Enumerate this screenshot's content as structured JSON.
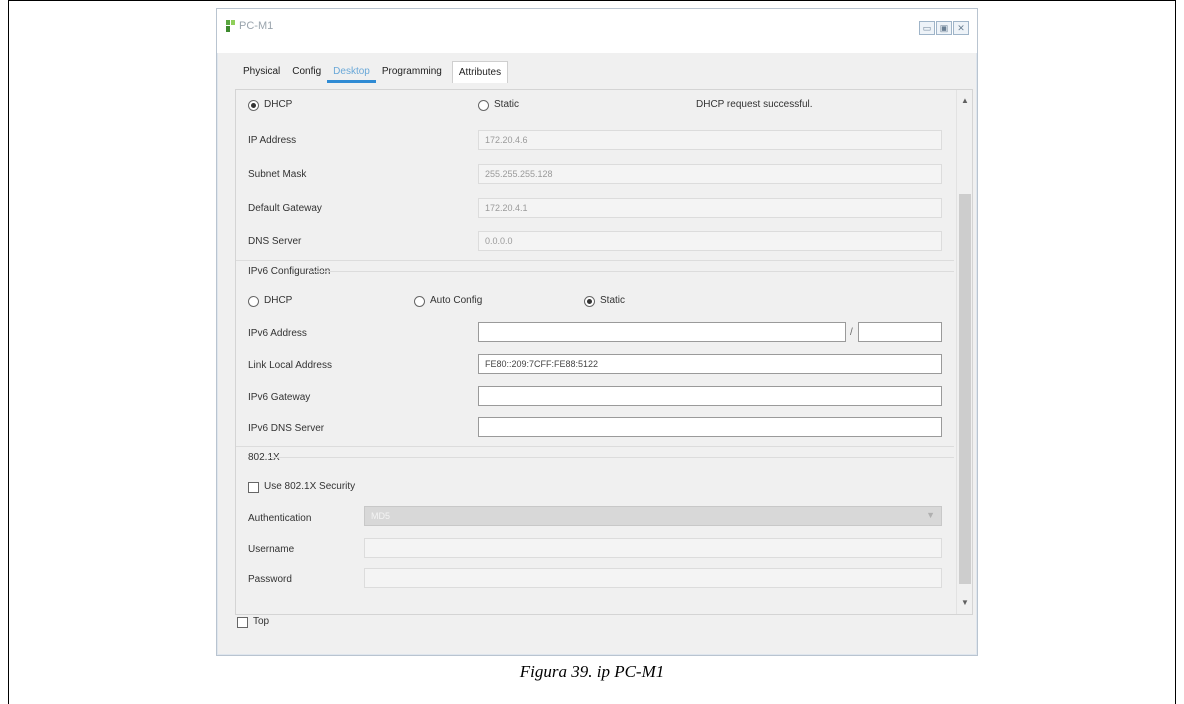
{
  "window": {
    "title": "PC-M1"
  },
  "tabs": [
    {
      "label": "Physical"
    },
    {
      "label": "Config"
    },
    {
      "label": "Desktop"
    },
    {
      "label": "Programming"
    },
    {
      "label": "Attributes"
    }
  ],
  "ipv4": {
    "dhcp_label": "DHCP",
    "static_label": "Static",
    "status": "DHCP request successful.",
    "ip_label": "IP Address",
    "ip_value": "172.20.4.6",
    "mask_label": "Subnet Mask",
    "mask_value": "255.255.255.128",
    "gateway_label": "Default Gateway",
    "gateway_value": "172.20.4.1",
    "dns_label": "DNS Server",
    "dns_value": "0.0.0.0"
  },
  "ipv6": {
    "section_label": "IPv6 Configuration",
    "dhcp_label": "DHCP",
    "auto_label": "Auto Config",
    "static_label": "Static",
    "address_label": "IPv6 Address",
    "address_value": "",
    "prefix_sep": "/",
    "prefix_value": "",
    "link_local_label": "Link Local Address",
    "link_local_value": "FE80::209:7CFF:FE88:5122",
    "gateway_label": "IPv6 Gateway",
    "gateway_value": "",
    "dns_label": "IPv6 DNS Server",
    "dns_value": ""
  },
  "dot1x": {
    "section_label": "802.1X",
    "use_label": "Use 802.1X Security",
    "auth_label": "Authentication",
    "auth_value": "MD5",
    "username_label": "Username",
    "password_label": "Password"
  },
  "footer": {
    "top_label": "Top"
  },
  "caption": "Figura 39.  ip PC-M1"
}
